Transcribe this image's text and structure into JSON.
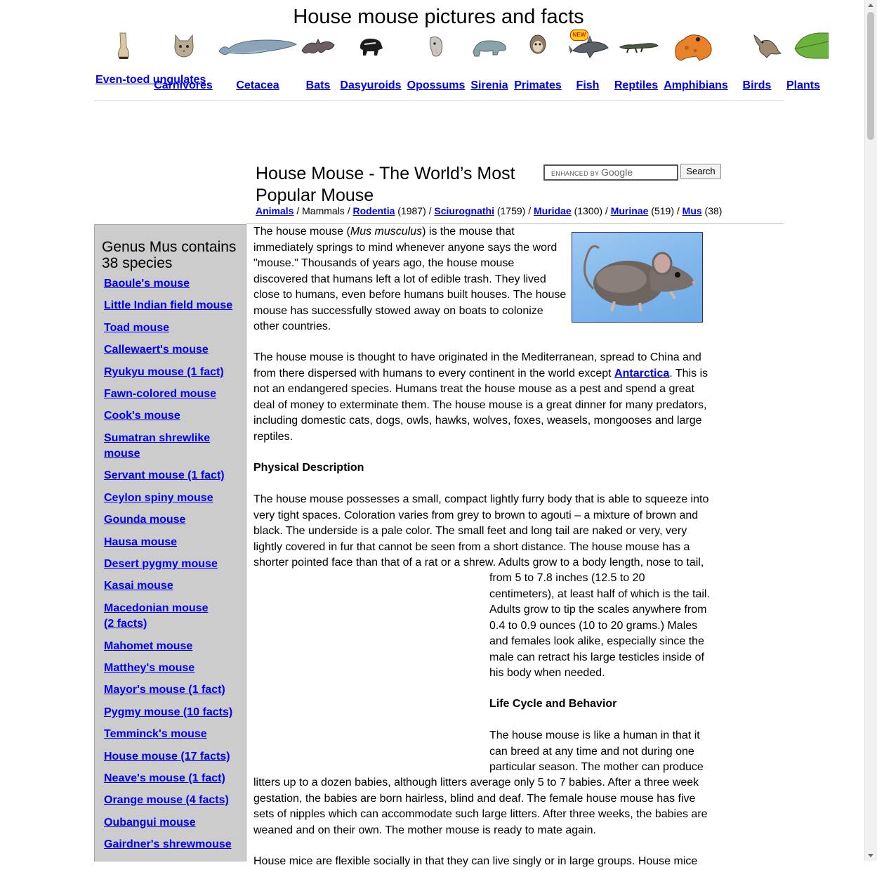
{
  "site": {
    "title": "House mouse pictures and facts"
  },
  "nav": [
    {
      "label": "Even-toed ungulates",
      "icon": "hoof-icon"
    },
    {
      "label": "Carnivores",
      "icon": "lynx-icon"
    },
    {
      "label": "Cetacea",
      "icon": "whale-icon"
    },
    {
      "label": "Bats",
      "icon": "bat-icon"
    },
    {
      "label": "Dasyuroids",
      "icon": "tasmanian-devil-icon"
    },
    {
      "label": "Opossums",
      "icon": "opossum-icon"
    },
    {
      "label": "Sirenia",
      "icon": "manatee-icon"
    },
    {
      "label": "Primates",
      "icon": "monkey-icon"
    },
    {
      "label": "Fish",
      "icon": "shark-icon"
    },
    {
      "label": "Reptiles",
      "icon": "crocodile-icon"
    },
    {
      "label": "Amphibians",
      "icon": "frog-icon"
    },
    {
      "label": "Birds",
      "icon": "bird-icon"
    },
    {
      "label": "Plants",
      "icon": "leaf-icon"
    }
  ],
  "fish_badge": "NEW",
  "page": {
    "title": "House Mouse - The World’s Most Popular Mouse"
  },
  "search": {
    "brand_prefix": "ENHANCED BY",
    "brand_name": "Google",
    "button_label": "Search"
  },
  "breadcrumb": {
    "animals": "Animals",
    "mammals": "Mammals",
    "rodentia": "Rodentia",
    "rodentia_count": "(1987)",
    "sciurognathi": "Sciurognathi",
    "sciurognathi_count": "(1759)",
    "muridae": "Muridae",
    "muridae_count": "(1300)",
    "murinae": "Murinae",
    "murinae_count": "(519)",
    "mus": "Mus",
    "mus_count": "(38)",
    "separator": " / "
  },
  "sidebar": {
    "title": "Genus Mus contains 38 species",
    "species": [
      "Baoule's mouse",
      "Little Indian field mouse",
      "Toad mouse",
      "Callewaert's mouse",
      "Ryukyu mouse (1 fact)",
      "Fawn-colored mouse",
      "Cook's mouse",
      "Sumatran shrewlike mouse",
      "Servant mouse (1 fact)",
      "Ceylon spiny mouse",
      "Gounda mouse",
      "Hausa mouse",
      "Desert pygmy mouse",
      "Kasai mouse",
      "Macedonian mouse (2 facts)",
      "Mahomet mouse",
      "Matthey's mouse",
      "Mayor's mouse (1 fact)",
      "Pygmy mouse (10 facts)",
      "Temminck's mouse",
      "House mouse (17 facts)",
      "Neave's mouse (1 fact)",
      "Orange mouse (4 facts)",
      "Oubangui mouse",
      "Gairdner's shrewmouse"
    ]
  },
  "article": {
    "p1_before": "The house mouse (",
    "p1_italic": "Mus musculus",
    "p1_after": ") is the mouse that immediately springs to mind whenever anyone says the word \"mouse.\" Thousands of years ago, the house mouse discovered that humans left a lot of edible trash. They lived close to humans, even before humans built houses. The house mouse has successfully stowed away on boats to colonize other countries.",
    "p2_before": "The house mouse is thought to have originated in the Mediterranean, spread to China and from there dispersed with humans to every continent in the world except ",
    "p2_link": "Antarctica",
    "p2_after": ". This is not an endangered species. Humans treat the house mouse as a pest and spend a great deal of money to exterminate them. The house mouse is a great dinner for many predators, including domestic cats, dogs, owls, hawks, wolves, foxes, weasels, mongooses and large reptiles.",
    "h_physical": "Physical Description",
    "p3": "The house mouse possesses a small, compact lightly furry body that is able to squeeze into very tight spaces. Coloration varies from grey to brown to agouti – a mixture of brown and black. The underside is a pale color. The small feet and long tail are naked or very, very lightly covered in fur that cannot be seen from a short distance. The house mouse has a shorter pointed face than that of a rat or a shrew. Adults grow to a body length, nose to tail,",
    "p3_cont": "from 5 to 7.8 inches (12.5 to 20 centimeters), at least half of which is the tail. Adults grow to tip the scales anywhere from 0.4 to 0.9 ounces (10 to 20 grams.) Males and females look alike, especially since the male can retract his large testicles inside of his body when needed.",
    "h_life": "Life Cycle and Behavior",
    "p4_start": "The house mouse is like a human in that it can breed at any time and not during one particular season. The mother can produce",
    "p4_cont": "litters up to a dozen babies, although litters average only 5 to 7 babies. After a three week gestation, the babies are born hairless, blind and deaf. The female house mouse has five sets of nipples which can accommodate such large litters. After three weeks, the babies are weaned and on their own. The mother mouse is ready to mate again.",
    "p5_partial": "House mice are flexible socially in that they can live singly or in large groups. House mice"
  }
}
